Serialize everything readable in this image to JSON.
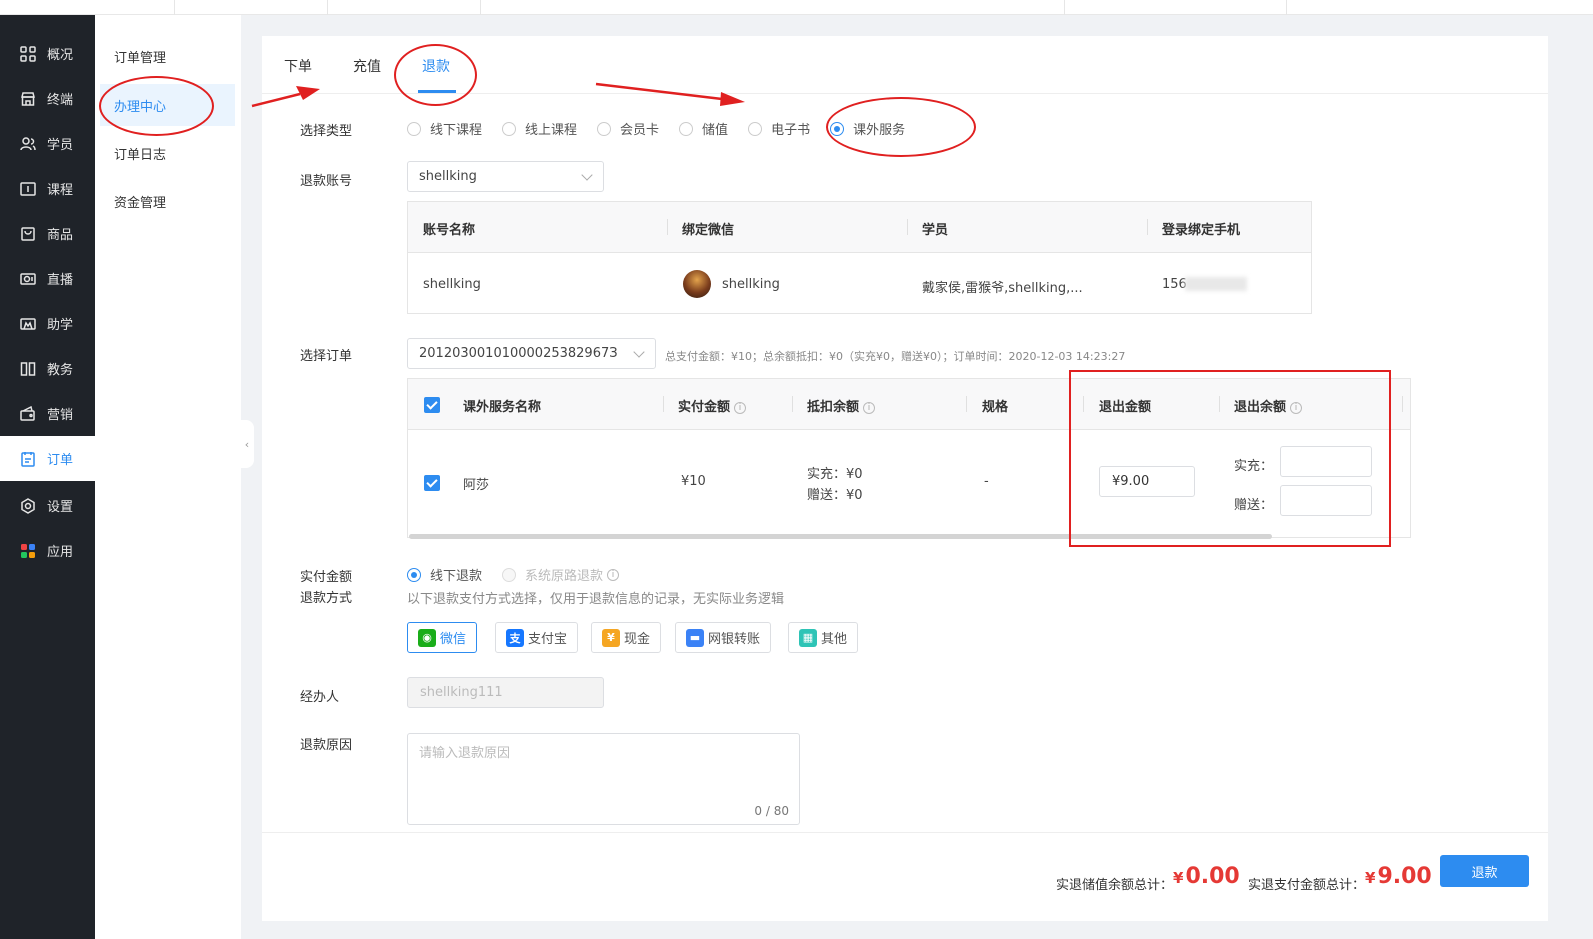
{
  "colors": {
    "accent": "#2d8cf0",
    "sidebar_bg": "#1f2329",
    "price_red": "#e53935",
    "annotation_red": "#e02020"
  },
  "sidebar": {
    "items": [
      {
        "label": "概况",
        "icon": "dashboard-icon"
      },
      {
        "label": "终端",
        "icon": "store-icon"
      },
      {
        "label": "学员",
        "icon": "users-icon"
      },
      {
        "label": "课程",
        "icon": "course-icon"
      },
      {
        "label": "商品",
        "icon": "product-icon"
      },
      {
        "label": "直播",
        "icon": "live-icon"
      },
      {
        "label": "助学",
        "icon": "assist-icon"
      },
      {
        "label": "教务",
        "icon": "academic-icon"
      },
      {
        "label": "营销",
        "icon": "marketing-icon"
      },
      {
        "label": "订单",
        "icon": "order-icon",
        "active": true
      },
      {
        "label": "设置",
        "icon": "settings-icon"
      },
      {
        "label": "应用",
        "icon": "apps-icon"
      }
    ]
  },
  "subnav": {
    "items": [
      {
        "label": "订单管理"
      },
      {
        "label": "办理中心",
        "active": true
      },
      {
        "label": "订单日志"
      },
      {
        "label": "资金管理"
      }
    ]
  },
  "tabs": [
    {
      "label": "下单"
    },
    {
      "label": "充值"
    },
    {
      "label": "退款",
      "active": true
    }
  ],
  "form": {
    "type_label": "选择类型",
    "types": [
      "线下课程",
      "线上课程",
      "会员卡",
      "储值",
      "电子书",
      "课外服务"
    ],
    "selected_type": "课外服务",
    "account_label": "退款账号",
    "account_value": "shellking",
    "account_table": {
      "headers": [
        "账号名称",
        "绑定微信",
        "学员",
        "登录绑定手机"
      ],
      "row": {
        "account": "shellking",
        "wechat": "shellking",
        "students": "戴家侯,雷猴爷,shellking,...",
        "phone": "156"
      }
    },
    "order_label": "选择订单",
    "order_value": "20120300101000025382967З",
    "order_info": "总支付金额：¥10；总余额抵扣：¥0（实充¥0，赠送¥0）；订单时间：2020-12-03 14:23:27",
    "service_table": {
      "headers": [
        "课外服务名称",
        "实付金额",
        "抵扣余额",
        "规格",
        "退出金额",
        "退出余额"
      ],
      "row": {
        "name": "阿莎",
        "paid": "¥10",
        "deduct_real": "实充：¥0",
        "deduct_gift": "赠送：¥0",
        "spec": "-",
        "refund_amount": "¥9.00",
        "refund_real_label": "实充：",
        "refund_gift_label": "赠送："
      }
    },
    "paid_method_label_1": "实付金额",
    "paid_method_label_2": "退款方式",
    "refund_options": [
      "线下退款",
      "系统原路退款"
    ],
    "refund_note": "以下退款支付方式选择，仅用于退款信息的记录，无实际业务逻辑",
    "pay_methods": [
      {
        "label": "微信",
        "icon": "wechat-icon",
        "color": "#1aad19",
        "active": true
      },
      {
        "label": "支付宝",
        "icon": "alipay-icon",
        "color": "#1677ff"
      },
      {
        "label": "现金",
        "icon": "cash-icon",
        "color": "#f5a623"
      },
      {
        "label": "网银转账",
        "icon": "bank-transfer-icon",
        "color": "#3b82f6"
      },
      {
        "label": "其他",
        "icon": "other-icon",
        "color": "#2ec4b6"
      }
    ],
    "handler_label": "经办人",
    "handler_value": "shellking111",
    "reason_label": "退款原因",
    "reason_placeholder": "请输入退款原因",
    "reason_count": "0 / 80"
  },
  "footer": {
    "stored_label": "实退储值余额总计：",
    "stored_value": "0.00",
    "paid_label": "实退支付金额总计：",
    "paid_value": "9.00",
    "currency": "¥",
    "refund_button": "退款"
  }
}
